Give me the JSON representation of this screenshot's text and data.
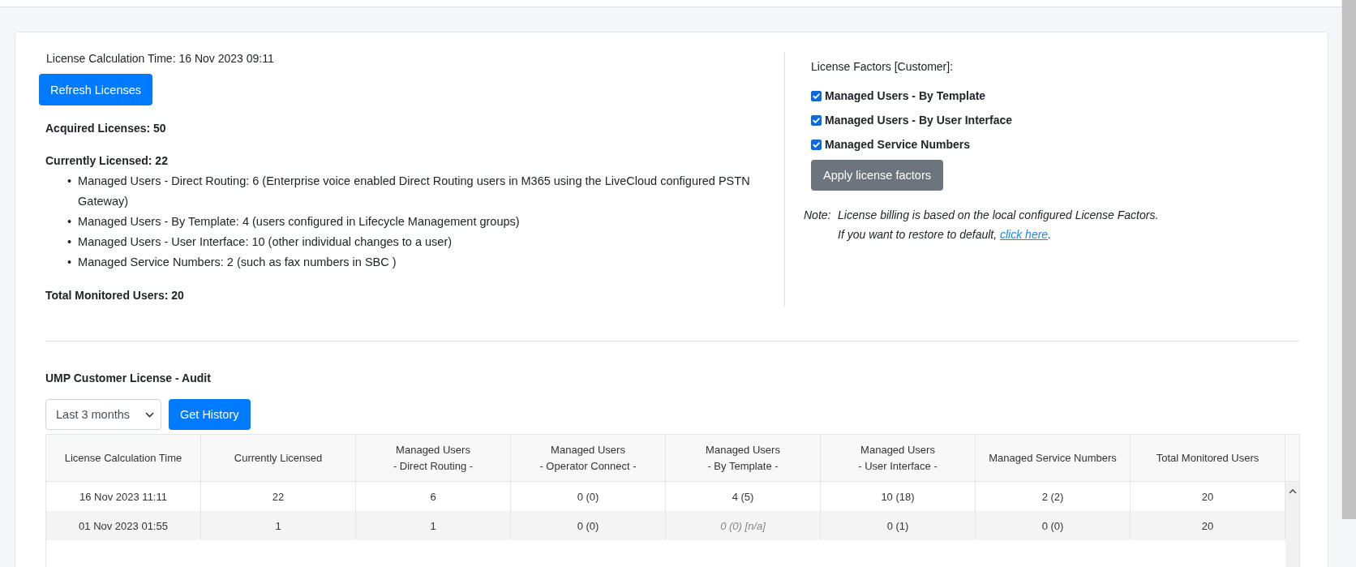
{
  "summary": {
    "calc_time": "License Calculation Time: 16 Nov 2023 09:11",
    "refresh_button": "Refresh Licenses",
    "acquired": "Acquired Licenses: 50",
    "currently_licensed": "Currently Licensed: 22",
    "items": [
      {
        "bullet": "•",
        "text": "Managed Users - Direct Routing: 6 (Enterprise voice enabled Direct Routing users in M365 using the LiveCloud configured PSTN Gateway)"
      },
      {
        "bullet": "•",
        "text": "Managed Users - By Template: 4 (users configured in Lifecycle Management groups)"
      },
      {
        "bullet": "•",
        "text": "Managed Users - User Interface: 10 (other individual changes to a user)"
      },
      {
        "bullet": "•",
        "text": "Managed Service Numbers: 2 (such as fax numbers in SBC )"
      }
    ],
    "total_monitored": "Total Monitored Users: 20"
  },
  "factors": {
    "title": "License Factors [Customer]:",
    "options": [
      {
        "label": "Managed Users - By Template",
        "checked": true
      },
      {
        "label": "Managed Users - By User Interface",
        "checked": true
      },
      {
        "label": "Managed Service Numbers",
        "checked": true
      }
    ],
    "apply_button": "Apply license factors",
    "note_label": "Note:",
    "note_line1": "License billing is based on the local configured License Factors.",
    "note_line2": "If you want to restore to default,",
    "note_link": "click here",
    "note_end": "."
  },
  "audit": {
    "title": "UMP Customer License - Audit",
    "period": "Last 3 months",
    "history_button": "Get History",
    "columns": [
      "License Calculation Time",
      "Currently Licensed",
      "Managed Users\n- Direct Routing -",
      "Managed Users\n- Operator Connect -",
      "Managed Users\n- By Template -",
      "Managed Users\n- User Interface -",
      "Managed Service Numbers",
      "Total Monitored Users"
    ],
    "rows": [
      [
        {
          "text": "16 Nov 2023 11:11",
          "muted": false
        },
        {
          "text": "22",
          "muted": false
        },
        {
          "text": "6",
          "muted": false
        },
        {
          "text": "0 (0)",
          "muted": false
        },
        {
          "text": "4 (5)",
          "muted": false
        },
        {
          "text": "10 (18)",
          "muted": false
        },
        {
          "text": "2 (2)",
          "muted": false
        },
        {
          "text": "20",
          "muted": false
        }
      ],
      [
        {
          "text": "01 Nov 2023 01:55",
          "muted": false
        },
        {
          "text": "1",
          "muted": false
        },
        {
          "text": "1",
          "muted": false
        },
        {
          "text": "0 (0)",
          "muted": false
        },
        {
          "text": "0 (0) [n/a]",
          "muted": true
        },
        {
          "text": "0 (1)",
          "muted": false
        },
        {
          "text": "0 (0)",
          "muted": false
        },
        {
          "text": "20",
          "muted": false
        }
      ]
    ]
  }
}
